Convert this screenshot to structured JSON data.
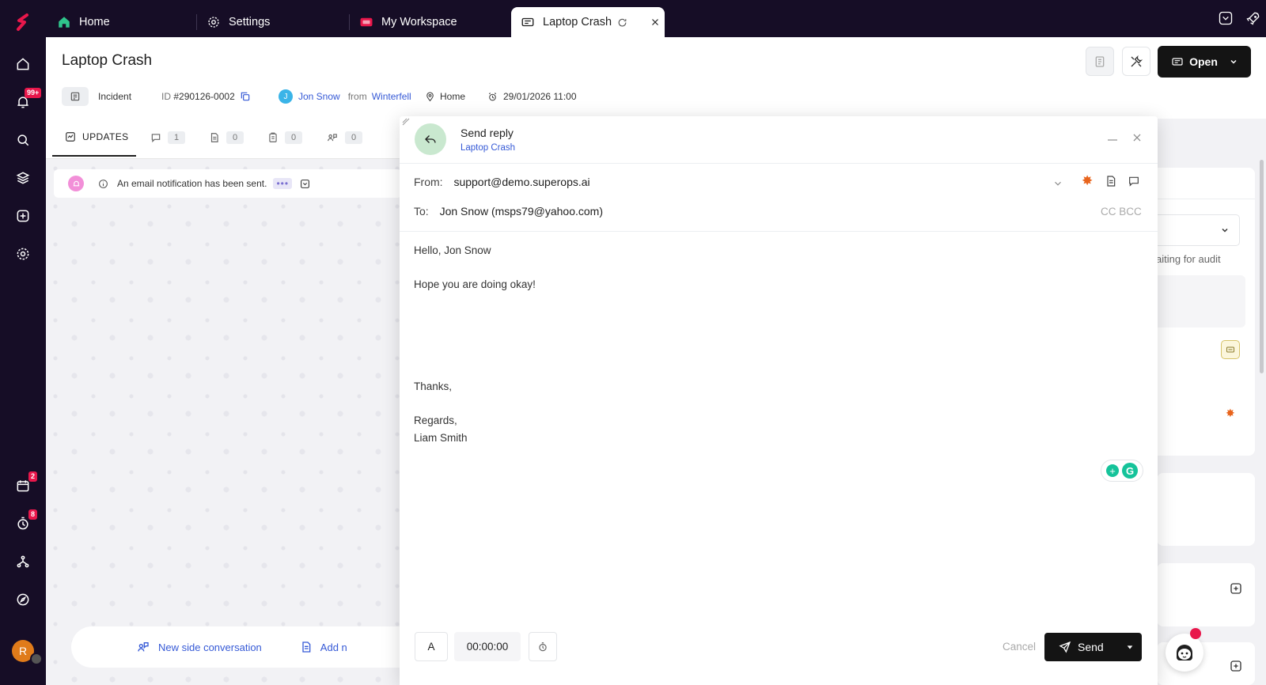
{
  "tabs": [
    {
      "label": "Home",
      "icon": "home-icon"
    },
    {
      "label": "Settings",
      "icon": "gear-icon"
    },
    {
      "label": "My Workspace",
      "icon": "workspace-icon"
    },
    {
      "label": "Laptop Crash",
      "icon": "ticket-icon"
    }
  ],
  "rail": {
    "notifications_badge": "99+",
    "calendar_badge": "2",
    "timer_badge": "8",
    "avatar_initial": "R"
  },
  "ticket": {
    "title": "Laptop Crash",
    "type": "Incident",
    "id_label": "ID",
    "id": "#290126-0002",
    "requester_initial": "J",
    "requester": "Jon Snow",
    "from_label": "from",
    "client": "Winterfell",
    "site": "Home",
    "datetime": "29/01/2026 11:00",
    "status": "Open"
  },
  "update_tabs": {
    "updates_label": "UPDATES",
    "comments_count": "1",
    "notes_count": "0",
    "tasks_count": "0",
    "side_conv_count": "0"
  },
  "notification": {
    "text": "An email notification has been sent."
  },
  "bottom_bar": {
    "new_side_conversation": "New side conversation",
    "add_partial": "Add n"
  },
  "right_panel": {
    "partial_text": "aiting for audit"
  },
  "reply": {
    "title": "Send reply",
    "subtitle": "Laptop Crash",
    "from_label": "From:",
    "from_value": "support@demo.superops.ai",
    "to_label": "To:",
    "to_value": "Jon Snow (msps79@yahoo.com)",
    "cc_bcc": "CC BCC",
    "greeting": "Hello, Jon Snow",
    "line1": "Hope you are doing okay!",
    "thanks": "Thanks,",
    "regards": "Regards,",
    "signature": "Liam Smith",
    "format_btn": "A",
    "timer": "00:00:00",
    "cancel": "Cancel",
    "send": "Send"
  },
  "colors": {
    "nav_bg": "#160d26",
    "accent_link": "#3559d6",
    "badge": "#e8174b",
    "reply_circle": "#c9e8cf",
    "primary_button": "#141414"
  }
}
